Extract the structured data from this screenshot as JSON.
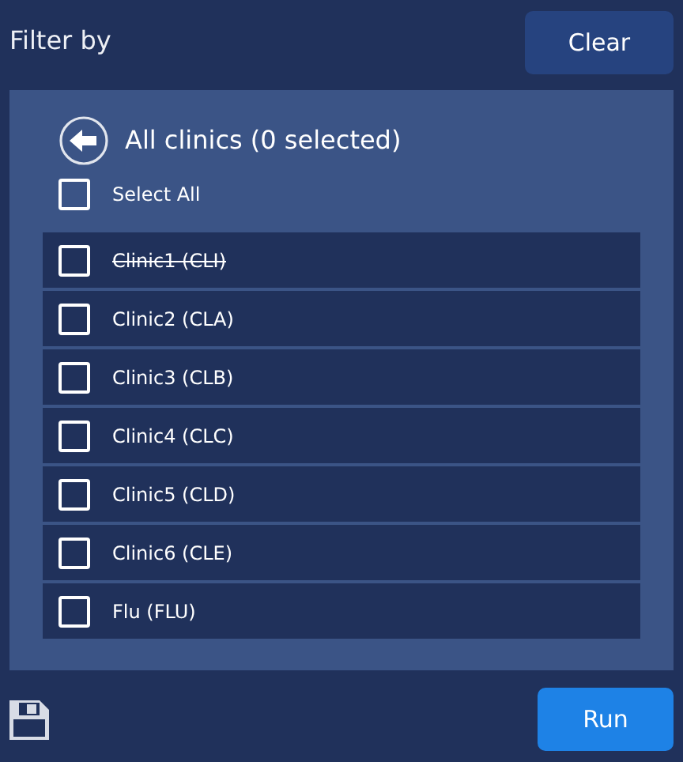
{
  "header": {
    "title": "Filter by",
    "clear_button": "Clear"
  },
  "panel": {
    "title": "All clinics (0 selected)",
    "select_all": {
      "label": "Select All",
      "checked": false
    },
    "items": [
      {
        "label": "Clinic1 (CLI)",
        "checked": false,
        "disabled": true
      },
      {
        "label": "Clinic2 (CLA)",
        "checked": false,
        "disabled": false
      },
      {
        "label": "Clinic3 (CLB)",
        "checked": false,
        "disabled": false
      },
      {
        "label": "Clinic4 (CLC)",
        "checked": false,
        "disabled": false
      },
      {
        "label": "Clinic5 (CLD)",
        "checked": false,
        "disabled": false
      },
      {
        "label": "Clinic6 (CLE)",
        "checked": false,
        "disabled": false
      },
      {
        "label": "Flu (FLU)",
        "checked": false,
        "disabled": false
      }
    ]
  },
  "footer": {
    "run_button": "Run"
  }
}
